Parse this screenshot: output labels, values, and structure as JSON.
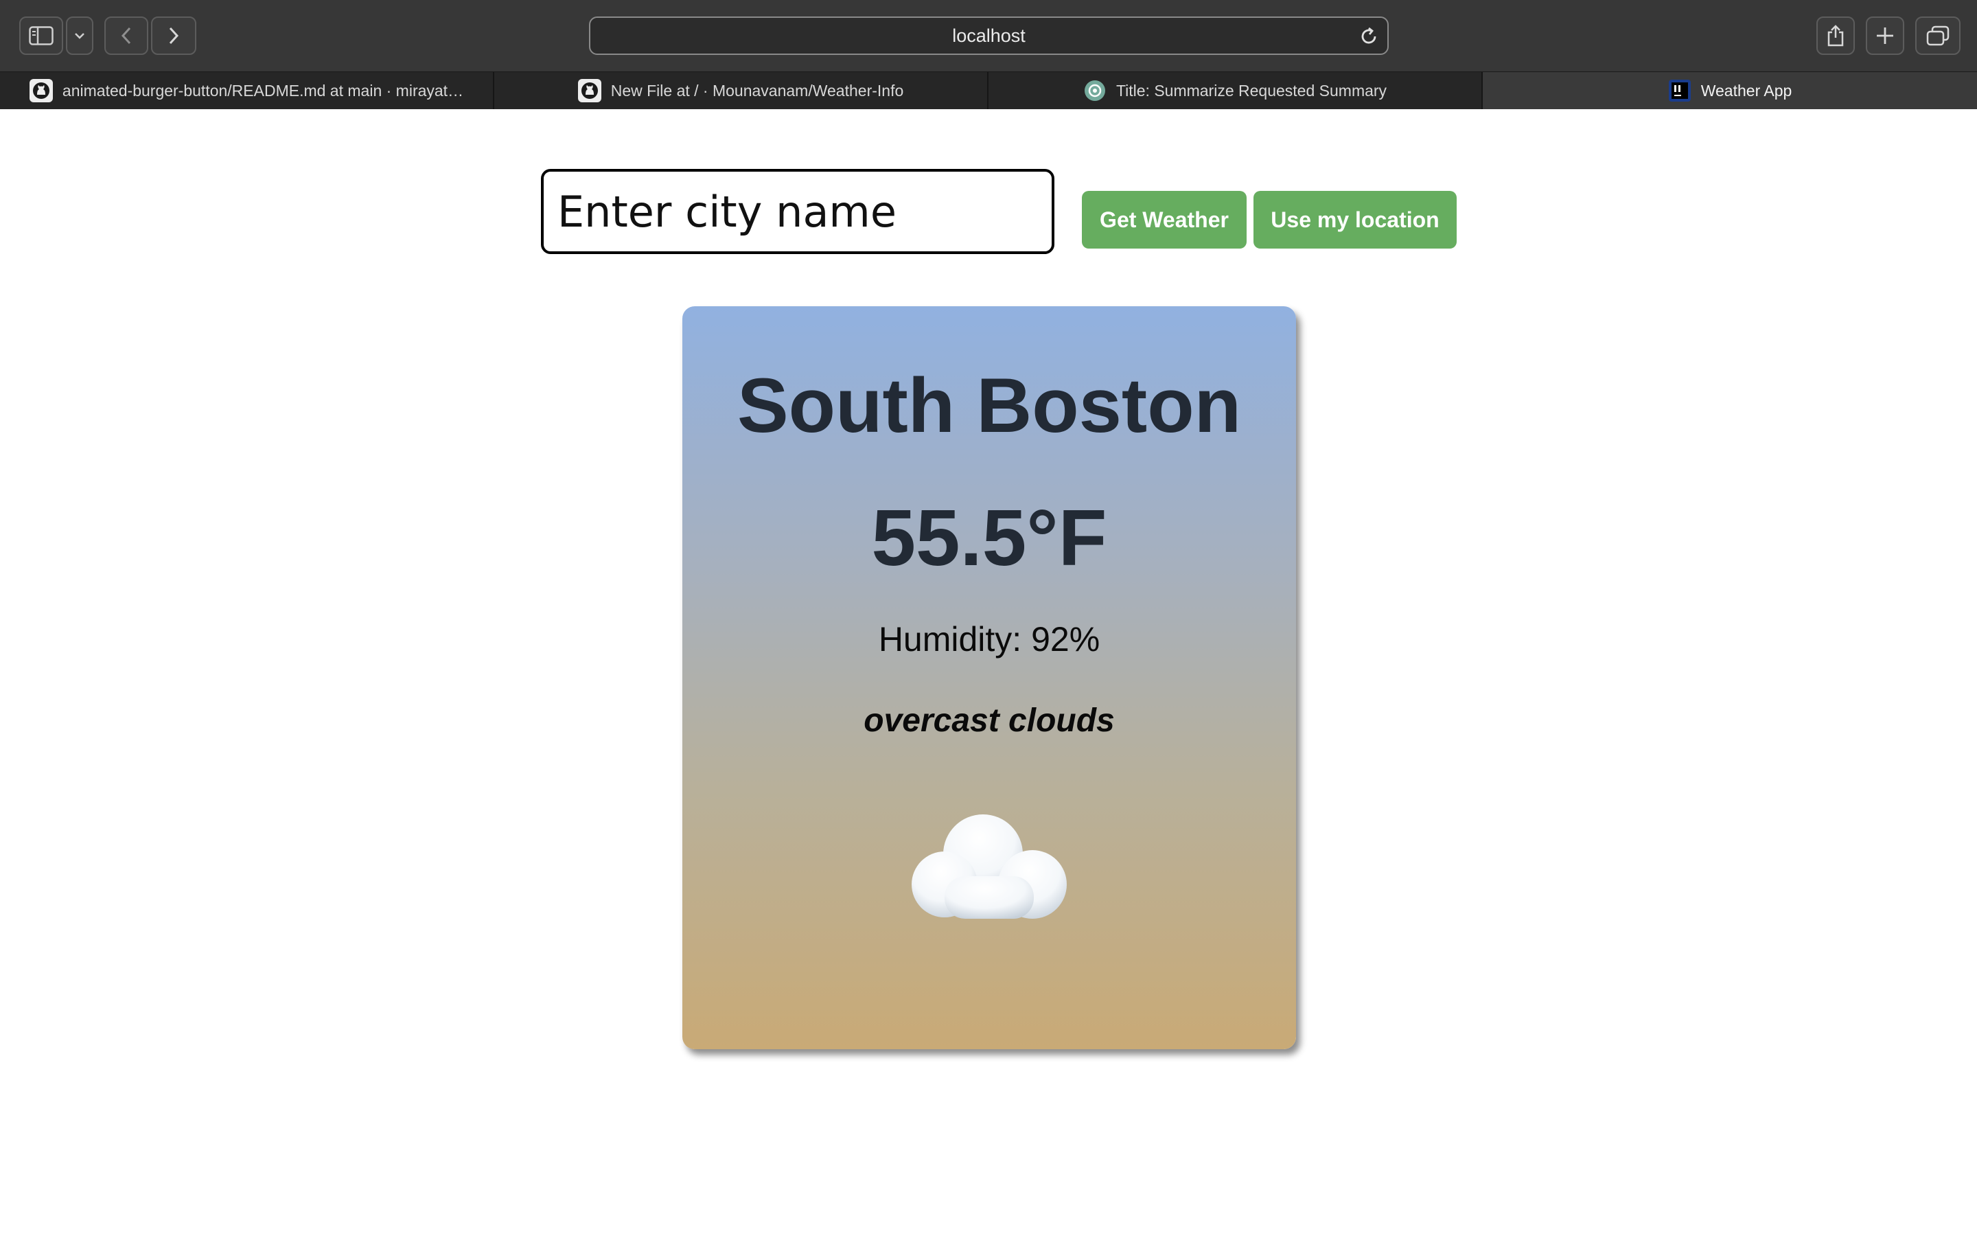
{
  "browser": {
    "address": "localhost",
    "tabs": [
      {
        "label": "animated-burger-button/README.md at main · mirayat…",
        "icon": "github-icon",
        "active": false
      },
      {
        "label": "New File at / · Mounavanam/Weather-Info",
        "icon": "github-icon",
        "active": false
      },
      {
        "label": "Title: Summarize Requested Summary",
        "icon": "chatgpt-icon",
        "active": false
      },
      {
        "label": "Weather App",
        "icon": "intellij-icon",
        "active": true
      }
    ]
  },
  "search": {
    "placeholder": "Enter city name",
    "value": "",
    "get_weather_label": "Get Weather",
    "use_location_label": "Use my location"
  },
  "weather": {
    "city": "South Boston",
    "temperature": "55.5°F",
    "humidity": "Humidity: 92%",
    "description": "overcast clouds",
    "icon": "cloud-icon"
  },
  "colors": {
    "button": "#66ad5f",
    "card_top": "#91b1e0",
    "card_bottom": "#c9aa76",
    "heading_text": "#222a35"
  }
}
